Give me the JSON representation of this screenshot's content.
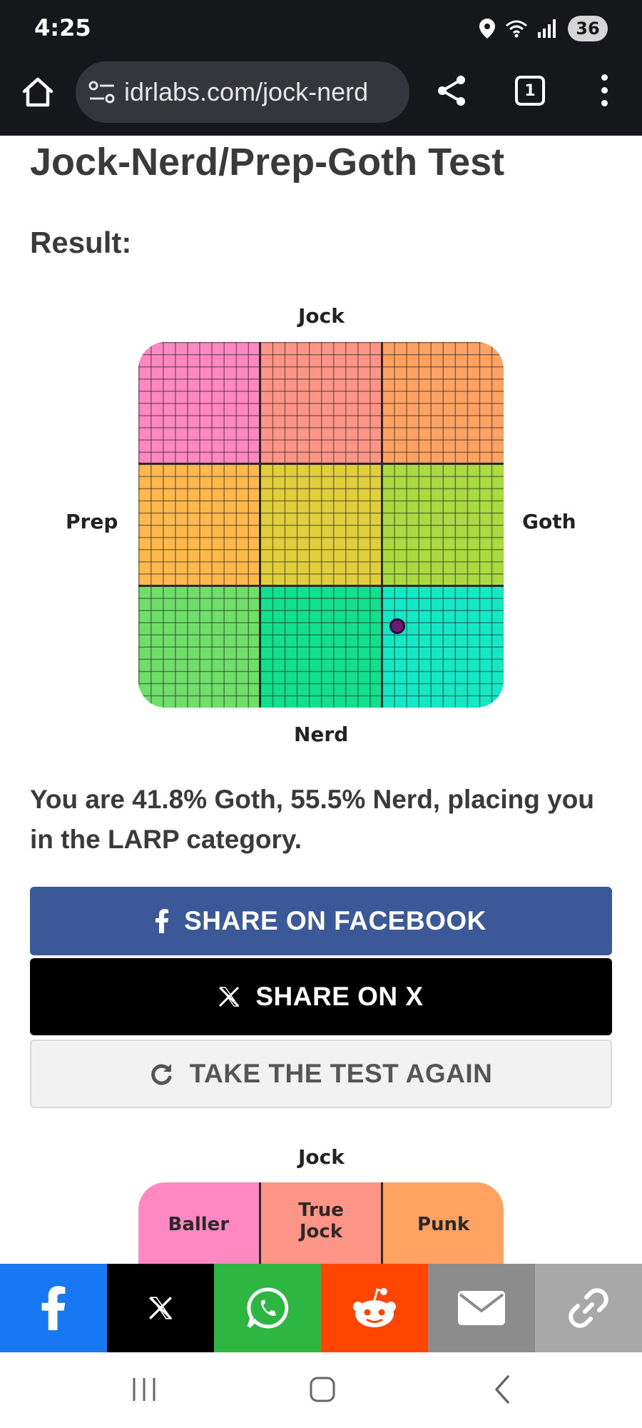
{
  "status_bar": {
    "time": "4:25",
    "battery": "36"
  },
  "browser": {
    "url": "idrlabs.com/jock-nerd",
    "tab_count": "1"
  },
  "page": {
    "title": "Jock-Nerd/Prep-Goth Test",
    "result_label": "Result:"
  },
  "chart": {
    "axes": {
      "top": "Jock",
      "bottom": "Nerd",
      "left": "Prep",
      "right": "Goth"
    },
    "quadrant_colors": [
      "#ff88c2",
      "#ff9586",
      "#ffa262",
      "#ffb84a",
      "#e0cf3a",
      "#aadb40",
      "#6ee06a",
      "#12e08c",
      "#14e8c4"
    ],
    "dot_color": "#6a1a7a"
  },
  "chart_data": {
    "type": "scatter",
    "x_axis": {
      "negative_label": "Prep",
      "positive_label": "Goth"
    },
    "y_axis": {
      "negative_label": "Nerd",
      "positive_label": "Jock"
    },
    "points": [
      {
        "goth_percent": 41.8,
        "nerd_percent": 55.5
      }
    ],
    "grid": true
  },
  "result": {
    "text": "You are 41.8% Goth, 55.5% Nerd, placing you in the LARP category."
  },
  "buttons": {
    "facebook": "SHARE ON FACEBOOK",
    "x": "SHARE ON X",
    "retake": "TAKE THE TEST AGAIN"
  },
  "chart2": {
    "top_label": "Jock",
    "cells": [
      {
        "label": "Baller",
        "color": "#ff88c2"
      },
      {
        "label": "True Jock",
        "color": "#ff9586"
      },
      {
        "label": "Punk",
        "color": "#ffa262"
      }
    ]
  },
  "share_bar": [
    {
      "icon": "facebook-icon",
      "color": "#1877f2"
    },
    {
      "icon": "x-icon",
      "color": "#000000"
    },
    {
      "icon": "whatsapp-icon",
      "color": "#2db742"
    },
    {
      "icon": "reddit-icon",
      "color": "#ff4500"
    },
    {
      "icon": "email-icon",
      "color": "#8c8c8c"
    },
    {
      "icon": "link-icon",
      "color": "#a8a8a8"
    }
  ]
}
